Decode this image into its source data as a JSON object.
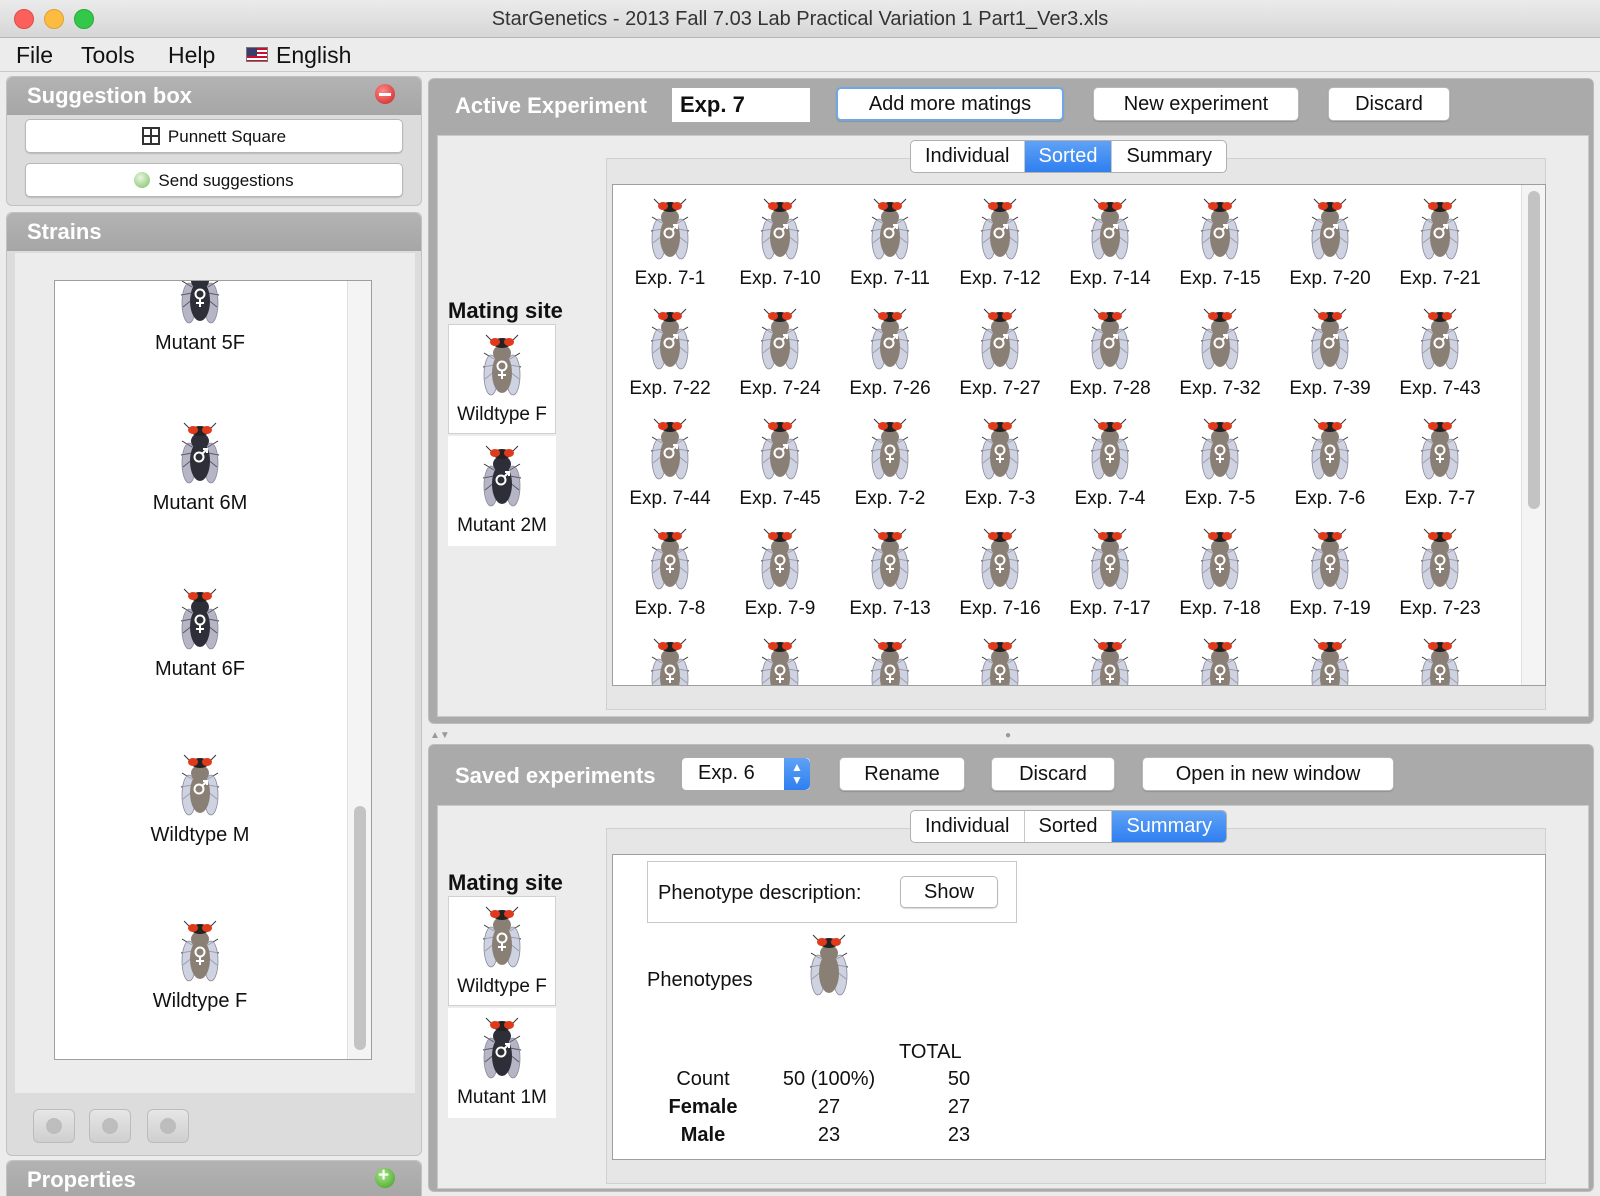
{
  "window": {
    "title": "StarGenetics - 2013 Fall 7.03 Lab Practical Variation 1 Part1_Ver3.xls"
  },
  "menu": {
    "file": "File",
    "tools": "Tools",
    "help": "Help",
    "language": "English"
  },
  "suggestion_box": {
    "title": "Suggestion box",
    "punnett_label": "Punnett Square",
    "send_label": "Send suggestions"
  },
  "strains": {
    "title": "Strains",
    "items": [
      {
        "label": "Mutant 5F",
        "sex": "F",
        "dark": true
      },
      {
        "label": "Mutant 6M",
        "sex": "M",
        "dark": true
      },
      {
        "label": "Mutant 6F",
        "sex": "F",
        "dark": true
      },
      {
        "label": "Wildtype M",
        "sex": "M",
        "dark": false
      },
      {
        "label": "Wildtype F",
        "sex": "F",
        "dark": false
      }
    ]
  },
  "properties": {
    "title": "Properties"
  },
  "active_experiment": {
    "title": "Active Experiment",
    "name_value": "Exp. 7",
    "add_label": "Add more matings",
    "new_label": "New experiment",
    "discard_label": "Discard",
    "tabs": [
      "Individual",
      "Sorted",
      "Summary"
    ],
    "selected_tab": "Sorted",
    "mating_title": "Mating site",
    "parents": [
      {
        "label": "Wildtype F",
        "sex": "F",
        "dark": false
      },
      {
        "label": "Mutant 2M",
        "sex": "M",
        "dark": true
      }
    ],
    "offspring": [
      {
        "label": "Exp. 7-1",
        "sex": "M"
      },
      {
        "label": "Exp. 7-10",
        "sex": "M"
      },
      {
        "label": "Exp. 7-11",
        "sex": "M"
      },
      {
        "label": "Exp. 7-12",
        "sex": "M"
      },
      {
        "label": "Exp. 7-14",
        "sex": "M"
      },
      {
        "label": "Exp. 7-15",
        "sex": "M"
      },
      {
        "label": "Exp. 7-20",
        "sex": "M"
      },
      {
        "label": "Exp. 7-21",
        "sex": "M"
      },
      {
        "label": "Exp. 7-22",
        "sex": "M"
      },
      {
        "label": "Exp. 7-24",
        "sex": "M"
      },
      {
        "label": "Exp. 7-26",
        "sex": "M"
      },
      {
        "label": "Exp. 7-27",
        "sex": "M"
      },
      {
        "label": "Exp. 7-28",
        "sex": "M"
      },
      {
        "label": "Exp. 7-32",
        "sex": "M"
      },
      {
        "label": "Exp. 7-39",
        "sex": "M"
      },
      {
        "label": "Exp. 7-43",
        "sex": "M"
      },
      {
        "label": "Exp. 7-44",
        "sex": "M"
      },
      {
        "label": "Exp. 7-45",
        "sex": "M"
      },
      {
        "label": "Exp. 7-2",
        "sex": "F"
      },
      {
        "label": "Exp. 7-3",
        "sex": "F"
      },
      {
        "label": "Exp. 7-4",
        "sex": "F"
      },
      {
        "label": "Exp. 7-5",
        "sex": "F"
      },
      {
        "label": "Exp. 7-6",
        "sex": "F"
      },
      {
        "label": "Exp. 7-7",
        "sex": "F"
      },
      {
        "label": "Exp. 7-8",
        "sex": "F"
      },
      {
        "label": "Exp. 7-9",
        "sex": "F"
      },
      {
        "label": "Exp. 7-13",
        "sex": "F"
      },
      {
        "label": "Exp. 7-16",
        "sex": "F"
      },
      {
        "label": "Exp. 7-17",
        "sex": "F"
      },
      {
        "label": "Exp. 7-18",
        "sex": "F"
      },
      {
        "label": "Exp. 7-19",
        "sex": "F"
      },
      {
        "label": "Exp. 7-23",
        "sex": "F"
      },
      {
        "label": "",
        "sex": "F"
      },
      {
        "label": "",
        "sex": "F"
      },
      {
        "label": "",
        "sex": "F"
      },
      {
        "label": "",
        "sex": "F"
      },
      {
        "label": "",
        "sex": "F"
      },
      {
        "label": "",
        "sex": "F"
      },
      {
        "label": "",
        "sex": "F"
      },
      {
        "label": "",
        "sex": "F"
      }
    ]
  },
  "saved_experiments": {
    "title": "Saved experiments",
    "selected": "Exp. 6",
    "rename_label": "Rename",
    "discard_label": "Discard",
    "open_label": "Open in new window",
    "tabs": [
      "Individual",
      "Sorted",
      "Summary"
    ],
    "selected_tab": "Summary",
    "mating_title": "Mating site",
    "parents": [
      {
        "label": "Wildtype F",
        "sex": "F",
        "dark": false
      },
      {
        "label": "Mutant 1M",
        "sex": "M",
        "dark": true
      }
    ],
    "phenotype_desc_label": "Phenotype description:",
    "show_label": "Show",
    "phenotypes_label": "Phenotypes",
    "table": {
      "total_header": "TOTAL",
      "rows": [
        {
          "label": "Count",
          "value": "50 (100%)",
          "total": "50"
        },
        {
          "label": "Female",
          "value": "27",
          "total": "27"
        },
        {
          "label": "Male",
          "value": "23",
          "total": "23"
        }
      ]
    }
  },
  "colors": {
    "accent": "#2f7ff0",
    "header_gray": "#aaaaaa",
    "fly_eye": "#e03a1c"
  }
}
